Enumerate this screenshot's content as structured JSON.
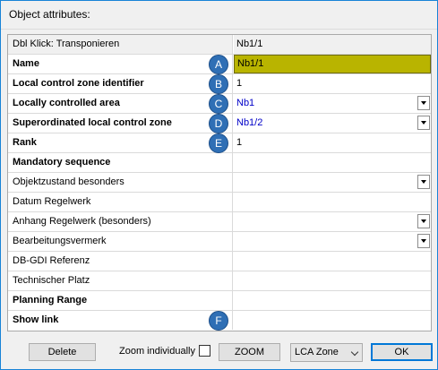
{
  "title": "Object attributes:",
  "header": {
    "left": "Dbl Klick: Transponieren",
    "right": "Nb1/1"
  },
  "rows": [
    {
      "label": "Name",
      "value": "Nb1/1",
      "badge": "A"
    },
    {
      "label": "Local control zone identifier",
      "value": "1",
      "badge": "B"
    },
    {
      "label": "Locally controlled area",
      "value": "Nb1",
      "badge": "C"
    },
    {
      "label": "Superordinated local control zone",
      "value": "Nb1/2",
      "badge": "D"
    },
    {
      "label": "Rank",
      "value": "1",
      "badge": "E"
    },
    {
      "label": "Mandatory sequence",
      "checked": false
    },
    {
      "label": "Objektzustand besonders"
    },
    {
      "label": "Datum Regelwerk"
    },
    {
      "label": "Anhang Regelwerk (besonders)"
    },
    {
      "label": "Bearbeitungsvermerk"
    },
    {
      "label": "DB-GDI Referenz"
    },
    {
      "label": "Technischer Platz"
    },
    {
      "label": "Planning Range",
      "checked": true
    },
    {
      "label": "Show link",
      "checked": false,
      "badge": "F"
    }
  ],
  "footer": {
    "delete_label": "Delete",
    "zoom_individually_label": "Zoom individually",
    "zoom_individually_checked": false,
    "zoom_label": "ZOOM",
    "zone_select_value": "LCA Zone",
    "ok_label": "OK"
  },
  "colors": {
    "name_highlight": "#b9b400",
    "badge": "#2f6fb5",
    "dropdown_text": "#0000c8"
  }
}
